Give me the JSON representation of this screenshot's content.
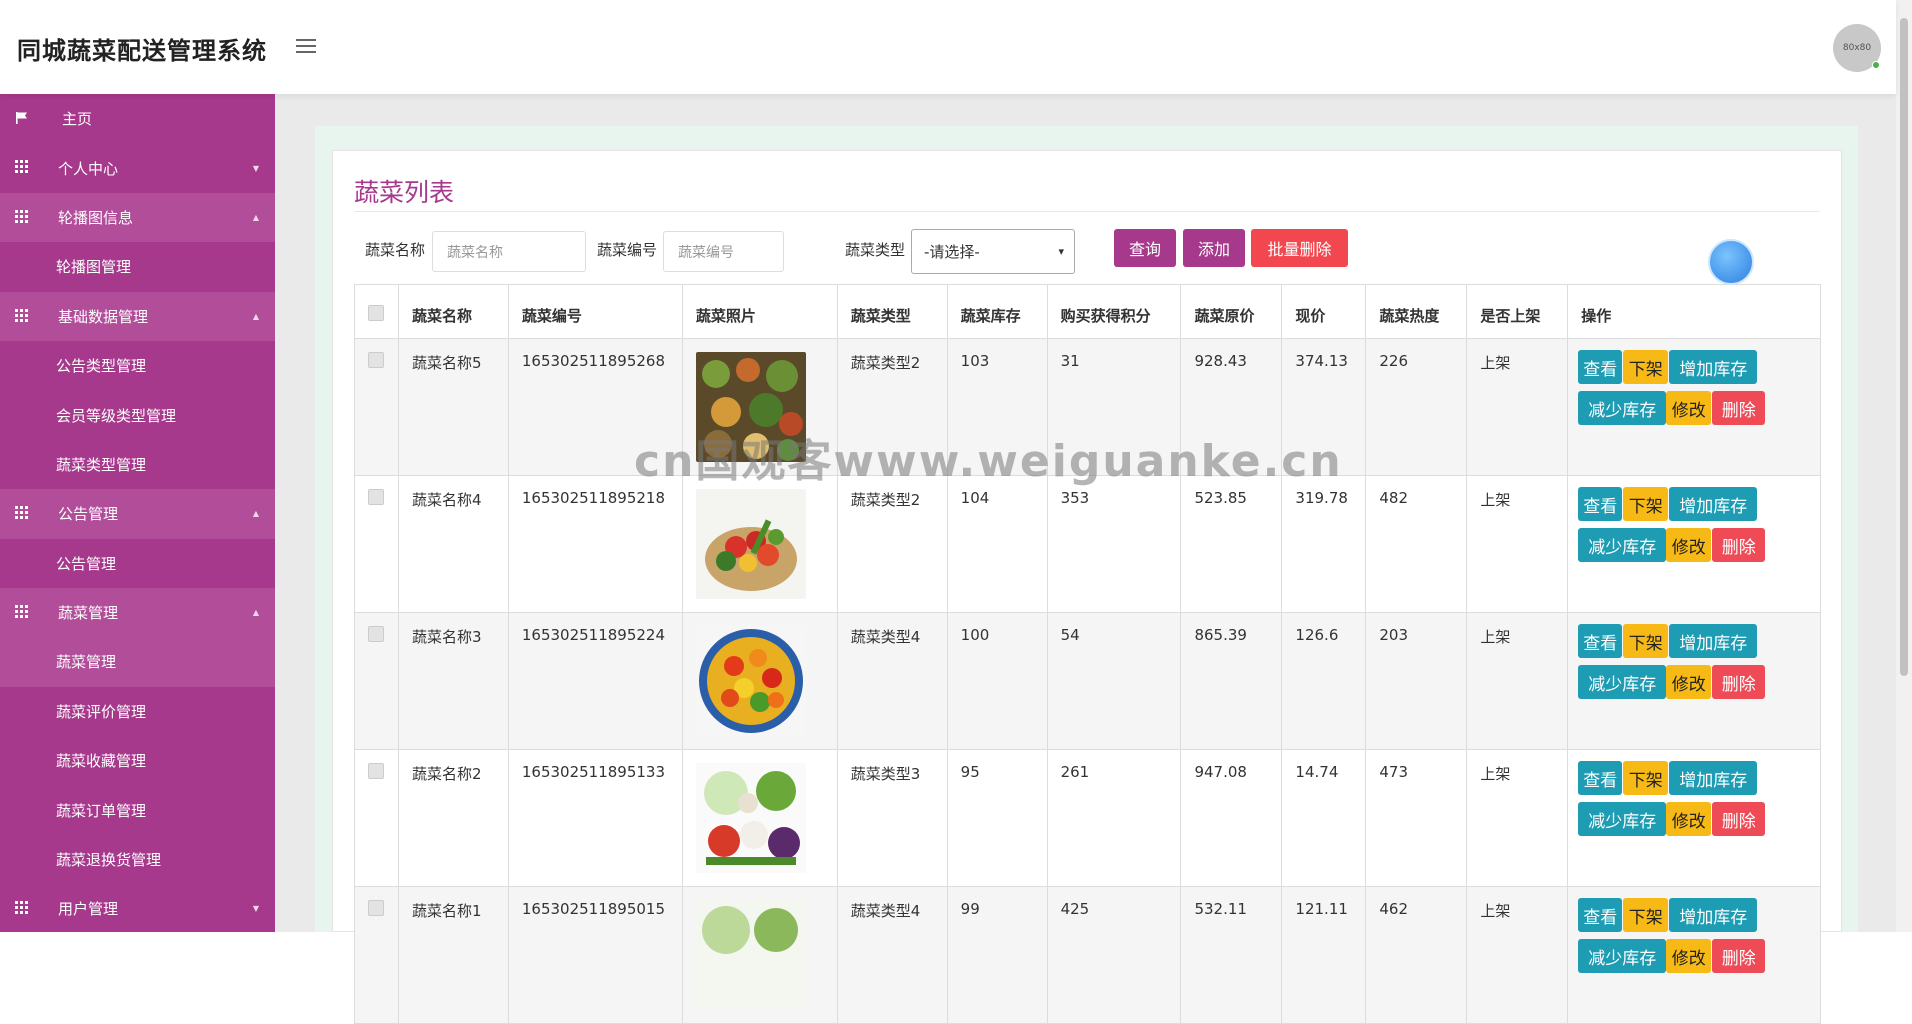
{
  "header": {
    "app_title": "同城蔬菜配送管理系统",
    "avatar_text": "80x80"
  },
  "sidebar": {
    "items": [
      {
        "label": "主页",
        "type": "group"
      },
      {
        "label": "个人中心",
        "type": "group",
        "caret": "▼"
      },
      {
        "label": "轮播图信息",
        "type": "group",
        "caret": "▲"
      },
      {
        "label": "轮播图管理",
        "type": "sub"
      },
      {
        "label": "基础数据管理",
        "type": "group",
        "caret": "▲"
      },
      {
        "label": "公告类型管理",
        "type": "sub"
      },
      {
        "label": "会员等级类型管理",
        "type": "sub"
      },
      {
        "label": "蔬菜类型管理",
        "type": "sub"
      },
      {
        "label": "公告管理",
        "type": "group",
        "caret": "▲"
      },
      {
        "label": "公告管理",
        "type": "sub"
      },
      {
        "label": "蔬菜管理",
        "type": "group",
        "caret": "▲"
      },
      {
        "label": "蔬菜管理",
        "type": "sub",
        "active": true
      },
      {
        "label": "蔬菜评价管理",
        "type": "sub"
      },
      {
        "label": "蔬菜收藏管理",
        "type": "sub"
      },
      {
        "label": "蔬菜订单管理",
        "type": "sub"
      },
      {
        "label": "蔬菜退换货管理",
        "type": "sub"
      },
      {
        "label": "用户管理",
        "type": "group",
        "caret": "▼"
      }
    ]
  },
  "page": {
    "title": "蔬菜列表"
  },
  "search": {
    "name_label": "蔬菜名称",
    "name_placeholder": "蔬菜名称",
    "code_label": "蔬菜编号",
    "code_placeholder": "蔬菜编号",
    "type_label": "蔬菜类型",
    "type_selected": "-请选择-",
    "query_btn": "查询",
    "add_btn": "添加",
    "batch_delete_btn": "批量删除"
  },
  "table": {
    "headers": [
      "蔬菜名称",
      "蔬菜编号",
      "蔬菜照片",
      "蔬菜类型",
      "蔬菜库存",
      "购买获得积分",
      "蔬菜原价",
      "现价",
      "蔬菜热度",
      "是否上架",
      "操作"
    ],
    "rows": [
      {
        "name": "蔬菜名称5",
        "code": "165302511895268",
        "photo": "mixed-vegetables-photo",
        "type": "蔬菜类型2",
        "stock": "103",
        "points": "31",
        "orig_price": "928.43",
        "price": "374.13",
        "heat": "226",
        "on_shelf": "上架"
      },
      {
        "name": "蔬菜名称4",
        "code": "165302511895218",
        "photo": "vegetable-basket-photo",
        "type": "蔬菜类型2",
        "stock": "104",
        "points": "353",
        "orig_price": "523.85",
        "price": "319.78",
        "heat": "482",
        "on_shelf": "上架"
      },
      {
        "name": "蔬菜名称3",
        "code": "165302511895224",
        "photo": "peppers-bowl-photo",
        "type": "蔬菜类型4",
        "stock": "100",
        "points": "54",
        "orig_price": "865.39",
        "price": "126.6",
        "heat": "203",
        "on_shelf": "上架"
      },
      {
        "name": "蔬菜名称2",
        "code": "165302511895133",
        "photo": "cabbage-vegetables-photo",
        "type": "蔬菜类型3",
        "stock": "95",
        "points": "261",
        "orig_price": "947.08",
        "price": "14.74",
        "heat": "473",
        "on_shelf": "上架"
      },
      {
        "name": "蔬菜名称1",
        "code": "165302511895015",
        "photo": "green-vegetables-photo",
        "type": "蔬菜类型4",
        "stock": "99",
        "points": "425",
        "orig_price": "532.11",
        "price": "121.11",
        "heat": "462",
        "on_shelf": "上架"
      }
    ],
    "ops": {
      "view": "查看",
      "off_shelf": "下架",
      "add_stock": "增加库存",
      "reduce_stock": "减少库存",
      "edit": "修改",
      "delete": "删除"
    }
  },
  "watermark": "cn国观客www.weiguanke.cn",
  "colors": {
    "sidebar": "#a6398c",
    "sidebar_active": "#b24d9a",
    "teal": "#1e9cb3",
    "yellow": "#f6b915",
    "red": "#ee4b57",
    "query": "#a6398c",
    "batch_delete": "#f2474f"
  }
}
